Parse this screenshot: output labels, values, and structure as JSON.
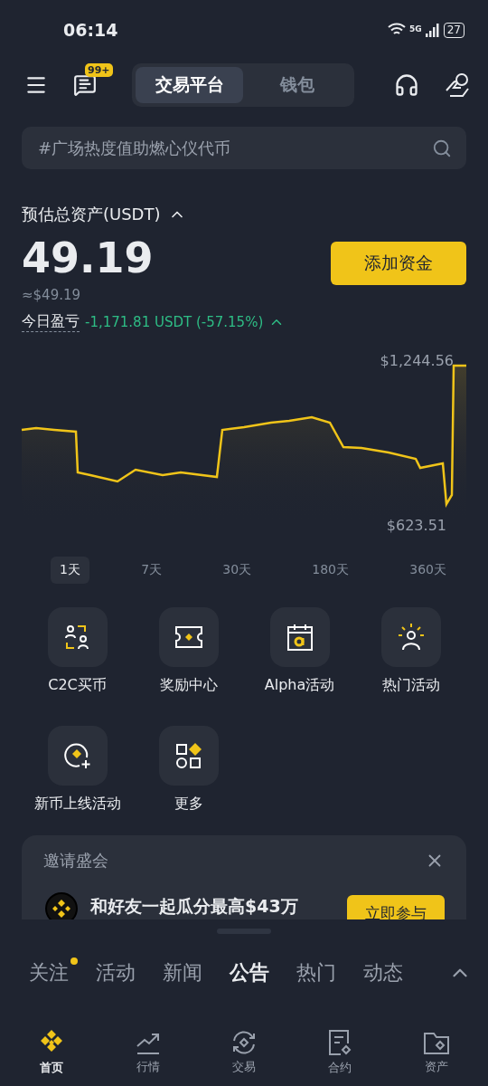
{
  "status_bar": {
    "time": "06:14",
    "network": "5G",
    "battery": "27"
  },
  "header": {
    "badge": "99+",
    "tabs": [
      {
        "label": "交易平台",
        "selected": true
      },
      {
        "label": "钱包",
        "selected": false
      }
    ]
  },
  "search": {
    "placeholder": "#广场热度值助燃心仪代币"
  },
  "assets": {
    "label": "预估总资产(USDT)",
    "value": "49.19",
    "approx": "≈$49.19",
    "pnl_label": "今日盈亏",
    "pnl": "-1,171.81 USDT (-57.15%)",
    "add_button": "添加资金"
  },
  "chart": {
    "max_label": "$1,244.56",
    "min_label": "$623.51"
  },
  "ranges": [
    {
      "label": "1天",
      "selected": true
    },
    {
      "label": "7天",
      "selected": false
    },
    {
      "label": "30天",
      "selected": false
    },
    {
      "label": "180天",
      "selected": false
    },
    {
      "label": "360天",
      "selected": false
    }
  ],
  "shortcuts": [
    {
      "kind": "c2c",
      "label": "C2C买币"
    },
    {
      "kind": "reward",
      "label": "奖励中心"
    },
    {
      "kind": "alpha",
      "label": "Alpha活动"
    },
    {
      "kind": "hot",
      "label": "热门活动"
    },
    {
      "kind": "listing",
      "label": "新币上线活动"
    },
    {
      "kind": "more",
      "label": "更多"
    }
  ],
  "banner": {
    "title": "邀请盛会",
    "text": "和好友一起瓜分最高$43万",
    "button": "立即参与"
  },
  "feed_tabs": [
    {
      "label": "关注",
      "selected": false,
      "dot": true
    },
    {
      "label": "活动",
      "selected": false,
      "dot": false
    },
    {
      "label": "新闻",
      "selected": false,
      "dot": false
    },
    {
      "label": "公告",
      "selected": true,
      "dot": false
    },
    {
      "label": "热门",
      "selected": false,
      "dot": false
    },
    {
      "label": "动态",
      "selected": false,
      "dot": false
    }
  ],
  "bottom_nav": [
    {
      "kind": "home",
      "label": "首页",
      "selected": true
    },
    {
      "kind": "markets",
      "label": "行情",
      "selected": false
    },
    {
      "kind": "trade",
      "label": "交易",
      "selected": false
    },
    {
      "kind": "futures",
      "label": "合约",
      "selected": false
    },
    {
      "kind": "assets",
      "label": "资产",
      "selected": false
    }
  ]
}
